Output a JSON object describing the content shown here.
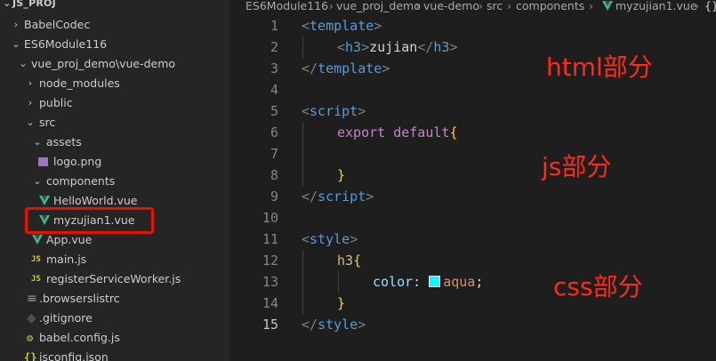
{
  "explorer": {
    "root": "JS_PROJ",
    "items": [
      {
        "label": "BabelCodec",
        "kind": "folder",
        "expanded": false
      },
      {
        "label": "ES6Module116",
        "kind": "folder",
        "expanded": true
      },
      {
        "label": "vue_proj_demo\\vue-demo",
        "kind": "folder",
        "expanded": true
      },
      {
        "label": "node_modules",
        "kind": "folder",
        "expanded": false
      },
      {
        "label": "public",
        "kind": "folder",
        "expanded": false
      },
      {
        "label": "src",
        "kind": "folder",
        "expanded": true
      },
      {
        "label": "assets",
        "kind": "folder",
        "expanded": true
      },
      {
        "label": "logo.png",
        "kind": "image"
      },
      {
        "label": "components",
        "kind": "folder",
        "expanded": true
      },
      {
        "label": "HelloWorld.vue",
        "kind": "vue"
      },
      {
        "label": "myzujian1.vue",
        "kind": "vue",
        "highlighted": true
      },
      {
        "label": "App.vue",
        "kind": "vue"
      },
      {
        "label": "main.js",
        "kind": "js",
        "icon": "JS"
      },
      {
        "label": "registerServiceWorker.js",
        "kind": "js",
        "icon": "JS"
      },
      {
        "label": ".browserslistrc",
        "kind": "dotfile"
      },
      {
        "label": ".gitignore",
        "kind": "git"
      },
      {
        "label": "babel.config.js",
        "kind": "babel"
      },
      {
        "label": "jsconfig.json",
        "kind": "json",
        "icon": "{}"
      }
    ]
  },
  "breadcrumb": [
    "ES6Module116",
    "vue_proj_demo",
    "vue-demo",
    "src",
    "components",
    "myzujian1.vue"
  ],
  "line_numbers": [
    "1",
    "2",
    "3",
    "4",
    "5",
    "6",
    "7",
    "8",
    "9",
    "10",
    "11",
    "12",
    "13",
    "14",
    "15"
  ],
  "code": {
    "l1_tag": "template",
    "l2_tag_open": "h3",
    "l2_text": "zujian",
    "l2_tag_close": "h3",
    "l3_tag": "template",
    "l5_tag": "script",
    "l6_kw1": "export",
    "l6_kw2": "default",
    "l6_brace": "{",
    "l8_brace": "}",
    "l9_tag": "script",
    "l11_tag": "style",
    "l12_selector": "h3",
    "l12_brace": "{",
    "l13_prop": "color",
    "l13_value": "aqua",
    "l14_brace": "}",
    "l15_tag": "style",
    "swatch_color": "#00ffff"
  },
  "annotations": {
    "html": "html部分",
    "js": "js部分",
    "css": "css部分"
  },
  "colors": {
    "annotation": "#ff2a1a",
    "highlight_box": "#e51400",
    "vue_green": "#42b883",
    "tag_blue": "#569cd6"
  }
}
